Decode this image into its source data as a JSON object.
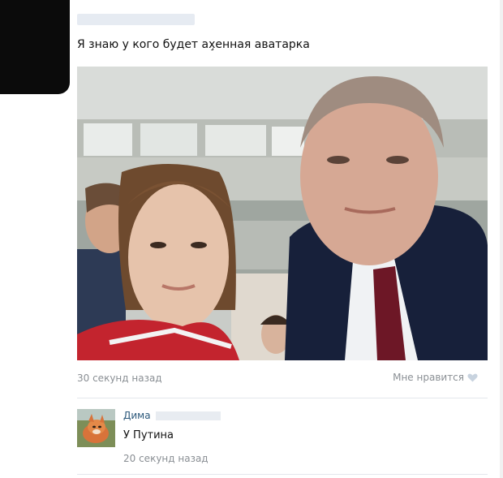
{
  "post": {
    "text": "Я знаю у кого будет ах̧енная аватарка",
    "time": "30 секунд назад",
    "like_label": "Мне нравится"
  },
  "comment": {
    "author_first": "Дима",
    "text": "У Путина",
    "time": "20 секунд назад"
  },
  "icons": {
    "like": "heart-icon"
  }
}
